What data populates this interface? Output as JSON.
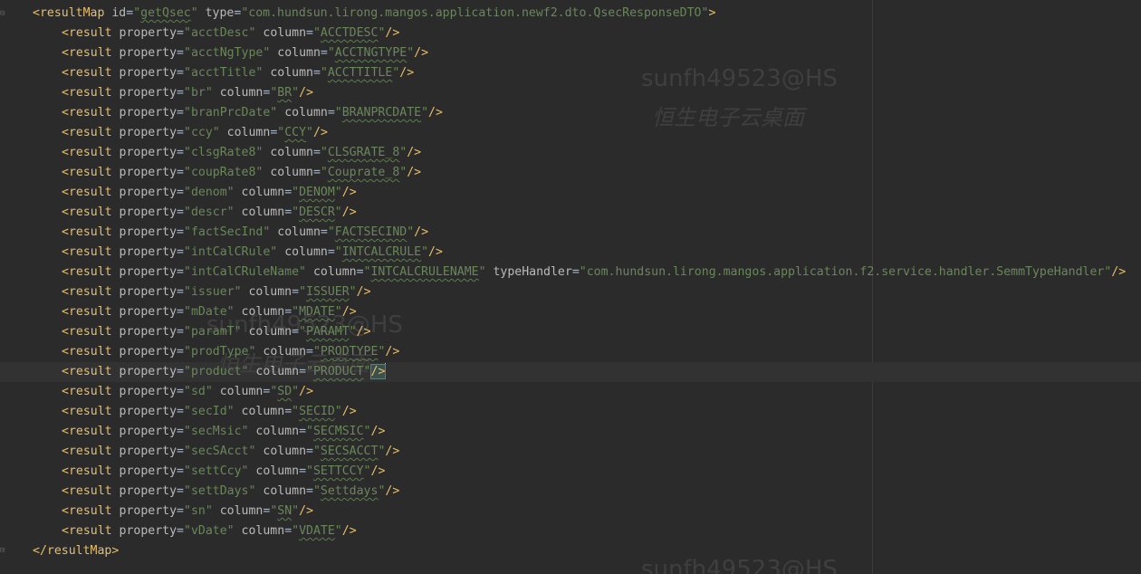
{
  "editor": {
    "watermark": {
      "account": "sunfh49523@HS",
      "desktop": "恒生电子云桌面"
    },
    "resultMap": {
      "id": "getQsec",
      "type": "com.hundsun.lirong.mangos.application.newf2.dto.QsecResponseDTO",
      "closing_tag": "resultMap"
    },
    "results": [
      {
        "property": "acctDesc",
        "column": "ACCTDESC"
      },
      {
        "property": "acctNgType",
        "column": "ACCTNGTYPE"
      },
      {
        "property": "acctTitle",
        "column": "ACCTTITLE"
      },
      {
        "property": "br",
        "column": "BR"
      },
      {
        "property": "branPrcDate",
        "column": "BRANPRCDATE"
      },
      {
        "property": "ccy",
        "column": "CCY"
      },
      {
        "property": "clsgRate8",
        "column": "CLSGRATE_8"
      },
      {
        "property": "coupRate8",
        "column": "Couprate_8"
      },
      {
        "property": "denom",
        "column": "DENOM"
      },
      {
        "property": "descr",
        "column": "DESCR"
      },
      {
        "property": "factSecInd",
        "column": "FACTSECIND"
      },
      {
        "property": "intCalCRule",
        "column": "INTCALCRULE"
      },
      {
        "property": "intCalCRuleName",
        "column": "INTCALCRULENAME",
        "typeHandler": "com.hundsun.lirong.mangos.application.f2.service.handler.SemmTypeHandler"
      },
      {
        "property": "issuer",
        "column": "ISSUER"
      },
      {
        "property": "mDate",
        "column": "MDATE"
      },
      {
        "property": "paramT",
        "column": "PARAMT"
      },
      {
        "property": "prodType",
        "column": "PRODTYPE"
      },
      {
        "property": "product",
        "column": "PRODUCT"
      },
      {
        "property": "sd",
        "column": "SD"
      },
      {
        "property": "secId",
        "column": "SECID"
      },
      {
        "property": "secMsic",
        "column": "SECMSIC"
      },
      {
        "property": "secSAcct",
        "column": "SECSACCT"
      },
      {
        "property": "settCcy",
        "column": "SETTCCY"
      },
      {
        "property": "settDays",
        "column": "Settdays"
      },
      {
        "property": "sn",
        "column": "SN"
      },
      {
        "property": "vDate",
        "column": "VDATE"
      }
    ],
    "current_line_index": 17
  }
}
